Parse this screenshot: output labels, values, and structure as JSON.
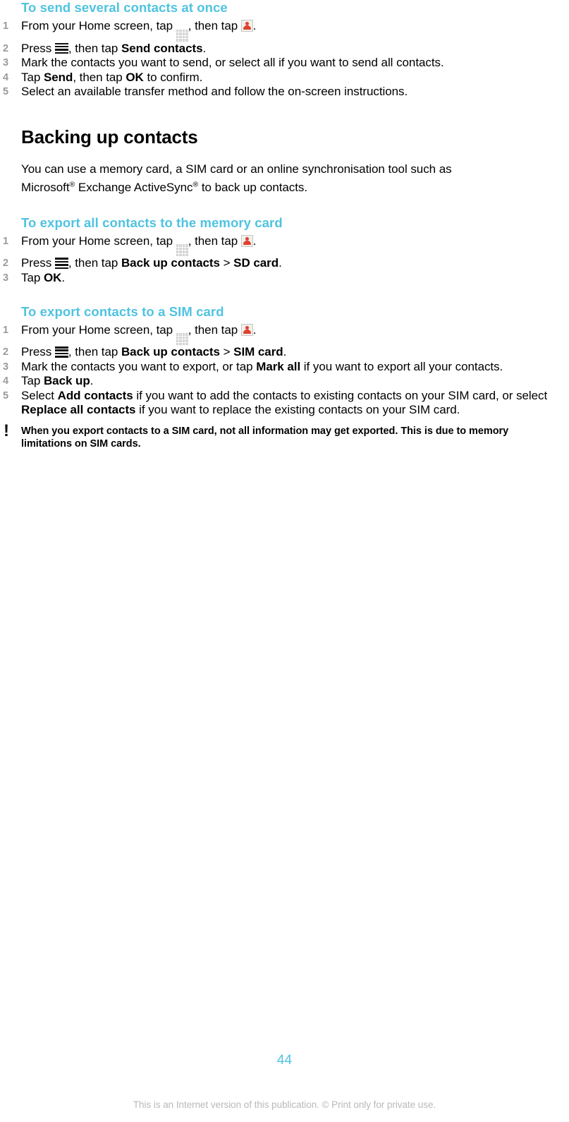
{
  "page": {
    "number": "44",
    "footer_note": "This is an Internet version of this publication. © Print only for private use.",
    "accent_color": "#4FC3E0",
    "text_color": "#000000",
    "step_number_color": "#9A9A9A",
    "footer_color": "#B9B9B9"
  },
  "icons": {
    "app_grid": "app-grid-icon",
    "contacts": "contacts-icon",
    "menu_key": "menu-key-icon",
    "note_bang": "exclamation-icon"
  },
  "sections": {
    "send_several": {
      "heading": "To send several contacts at once",
      "steps": [
        {
          "num": "1",
          "parts": [
            {
              "t": "text",
              "v": "From your Home screen, tap "
            },
            {
              "t": "icon",
              "v": "app-grid-icon"
            },
            {
              "t": "text",
              "v": ", then tap "
            },
            {
              "t": "icon",
              "v": "contacts-icon"
            },
            {
              "t": "text",
              "v": "."
            }
          ]
        },
        {
          "num": "2",
          "parts": [
            {
              "t": "text",
              "v": "Press "
            },
            {
              "t": "icon",
              "v": "menu-key-icon"
            },
            {
              "t": "text",
              "v": ", then tap "
            },
            {
              "t": "bold",
              "v": "Send contacts"
            },
            {
              "t": "text",
              "v": "."
            }
          ]
        },
        {
          "num": "3",
          "parts": [
            {
              "t": "text",
              "v": "Mark the contacts you want to send, or select all if you want to send all contacts."
            }
          ]
        },
        {
          "num": "4",
          "parts": [
            {
              "t": "text",
              "v": "Tap "
            },
            {
              "t": "bold",
              "v": "Send"
            },
            {
              "t": "text",
              "v": ", then tap "
            },
            {
              "t": "bold",
              "v": "OK"
            },
            {
              "t": "text",
              "v": " to confirm."
            }
          ]
        },
        {
          "num": "5",
          "parts": [
            {
              "t": "text",
              "v": "Select an available transfer method and follow the on-screen instructions."
            }
          ]
        }
      ]
    },
    "backing_up": {
      "heading": "Backing up contacts",
      "paragraph_line1": "You can use a memory card, a SIM card or an online synchronisation tool such as",
      "paragraph_line2_a": "Microsoft",
      "paragraph_line2_sup1": "®",
      "paragraph_line2_b": " Exchange ActiveSync",
      "paragraph_line2_sup2": "®",
      "paragraph_line2_c": " to back up contacts."
    },
    "export_memory_card": {
      "heading": "To export all contacts to the memory card",
      "steps": [
        {
          "num": "1",
          "parts": [
            {
              "t": "text",
              "v": "From your Home screen, tap "
            },
            {
              "t": "icon",
              "v": "app-grid-icon"
            },
            {
              "t": "text",
              "v": ", then tap "
            },
            {
              "t": "icon",
              "v": "contacts-icon"
            },
            {
              "t": "text",
              "v": "."
            }
          ]
        },
        {
          "num": "2",
          "parts": [
            {
              "t": "text",
              "v": "Press "
            },
            {
              "t": "icon",
              "v": "menu-key-icon"
            },
            {
              "t": "text",
              "v": ", then tap "
            },
            {
              "t": "bold",
              "v": "Back up contacts"
            },
            {
              "t": "text",
              "v": " > "
            },
            {
              "t": "bold",
              "v": "SD card"
            },
            {
              "t": "text",
              "v": "."
            }
          ]
        },
        {
          "num": "3",
          "parts": [
            {
              "t": "text",
              "v": "Tap "
            },
            {
              "t": "bold",
              "v": "OK"
            },
            {
              "t": "text",
              "v": "."
            }
          ]
        }
      ]
    },
    "export_sim_card": {
      "heading": "To export contacts to a SIM card",
      "steps": [
        {
          "num": "1",
          "parts": [
            {
              "t": "text",
              "v": "From your Home screen, tap "
            },
            {
              "t": "icon",
              "v": "app-grid-icon"
            },
            {
              "t": "text",
              "v": ", then tap "
            },
            {
              "t": "icon",
              "v": "contacts-icon"
            },
            {
              "t": "text",
              "v": "."
            }
          ]
        },
        {
          "num": "2",
          "parts": [
            {
              "t": "text",
              "v": "Press "
            },
            {
              "t": "icon",
              "v": "menu-key-icon"
            },
            {
              "t": "text",
              "v": ", then tap "
            },
            {
              "t": "bold",
              "v": "Back up contacts"
            },
            {
              "t": "text",
              "v": " > "
            },
            {
              "t": "bold",
              "v": "SIM card"
            },
            {
              "t": "text",
              "v": "."
            }
          ]
        },
        {
          "num": "3",
          "parts": [
            {
              "t": "text",
              "v": "Mark the contacts you want to export, or tap "
            },
            {
              "t": "bold",
              "v": "Mark all"
            },
            {
              "t": "text",
              "v": " if you want to export all your contacts."
            }
          ]
        },
        {
          "num": "4",
          "parts": [
            {
              "t": "text",
              "v": "Tap "
            },
            {
              "t": "bold",
              "v": "Back up"
            },
            {
              "t": "text",
              "v": "."
            }
          ]
        },
        {
          "num": "5",
          "parts": [
            {
              "t": "text",
              "v": "Select "
            },
            {
              "t": "bold",
              "v": "Add contacts"
            },
            {
              "t": "text",
              "v": " if you want to add the contacts to existing contacts on your SIM card, or select "
            },
            {
              "t": "bold",
              "v": "Replace all contacts"
            },
            {
              "t": "text",
              "v": " if you want to replace the existing contacts on your SIM card."
            }
          ]
        }
      ]
    },
    "note": {
      "bang": "!",
      "text": "When you export contacts to a SIM card, not all information may get exported. This is due to memory limitations on SIM cards."
    }
  }
}
